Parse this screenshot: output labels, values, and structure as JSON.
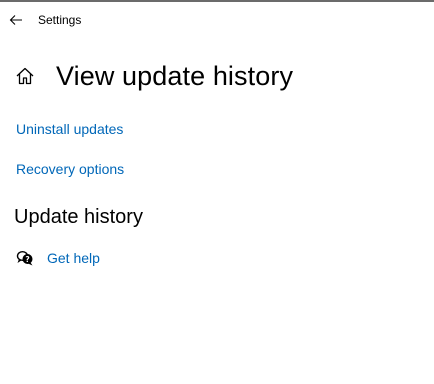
{
  "window": {
    "app_title": "Settings"
  },
  "page": {
    "title": "View update history"
  },
  "links": {
    "uninstall_updates": "Uninstall updates",
    "recovery_options": "Recovery options"
  },
  "section": {
    "title": "Update history"
  },
  "help": {
    "label": "Get help"
  },
  "icons": {
    "back": "back-arrow-icon",
    "home": "home-icon",
    "help": "help-chat-icon"
  },
  "colors": {
    "link": "#0067b8",
    "text": "#000000",
    "background": "#ffffff"
  }
}
